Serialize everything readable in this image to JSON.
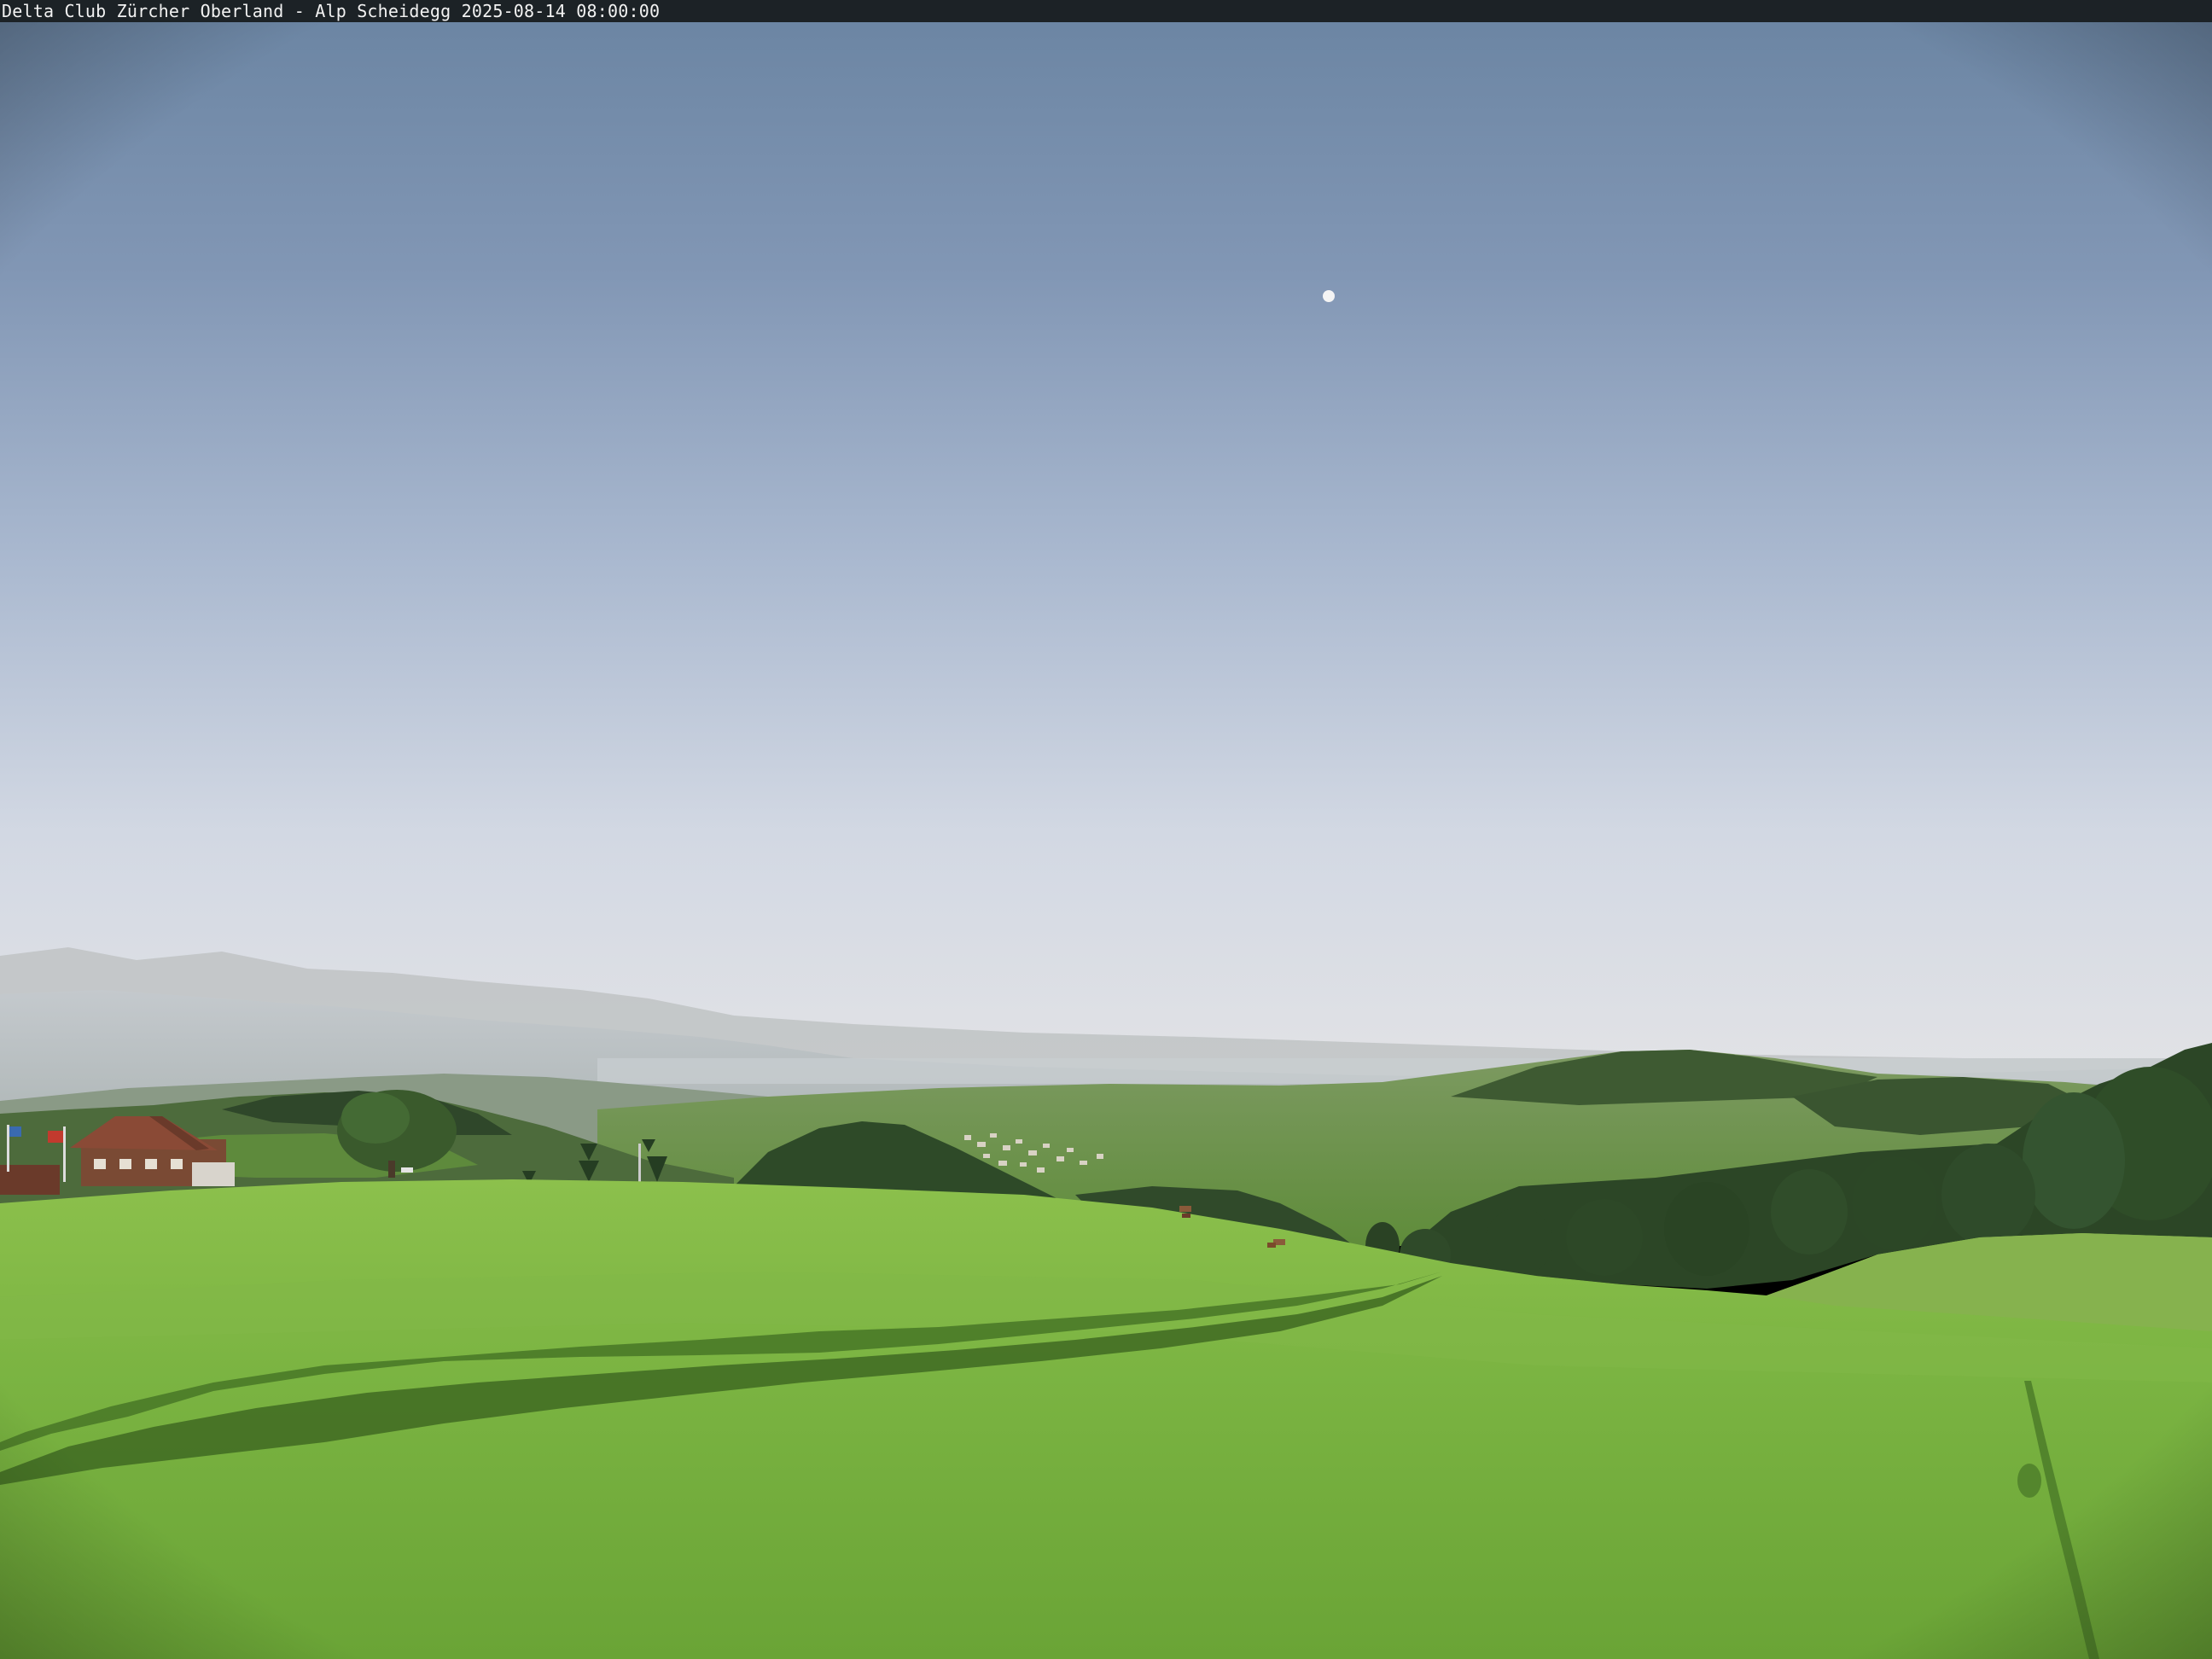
{
  "overlay": {
    "caption": "Delta Club Zürcher Oberland - Alp Scheidegg 2025-08-14 08:00:00"
  },
  "colors": {
    "sky_top": "#6b85a3",
    "sky_mid": "#a6b6cf",
    "sky_horizon": "#e6e8ee",
    "haze": "#c9cdd2",
    "hills_far": "#9ea6a6",
    "hills_mid": "#6e8a5c",
    "forest": "#2f4a2a",
    "meadow_light": "#8ec24e",
    "meadow_dark": "#5a8a2a",
    "shadow": "#3f6a22",
    "chalet_roof": "#8a4a36",
    "overlay_bar": "#1c2226"
  },
  "scene": {
    "elements": [
      "moon",
      "alps-haze",
      "distant-hills",
      "village",
      "forest-ridge",
      "chalet",
      "flag",
      "trees",
      "cows",
      "meadow",
      "tree-shadow",
      "pole-shadow"
    ]
  }
}
